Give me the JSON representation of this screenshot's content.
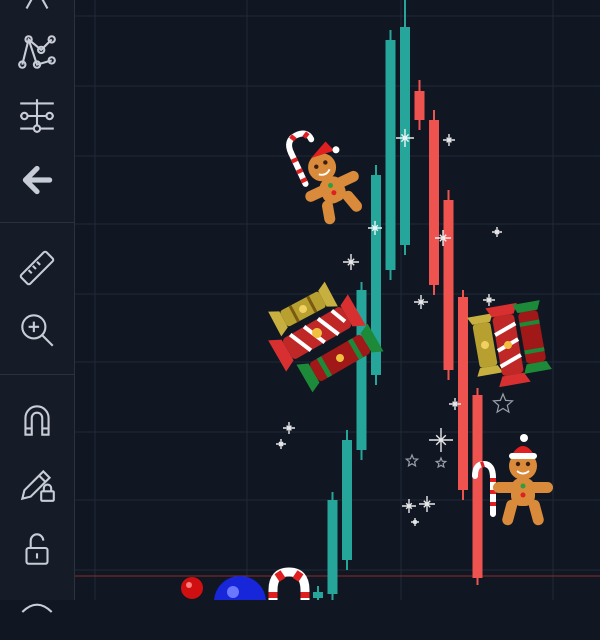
{
  "toolbar": {
    "tools": [
      {
        "name": "draw-tool-icon",
        "label": ""
      },
      {
        "name": "pattern-tool-icon",
        "label": ""
      },
      {
        "name": "measure-range-icon",
        "label": ""
      },
      {
        "name": "back-arrow-icon",
        "label": ""
      },
      {
        "name": "ruler-icon",
        "label": ""
      },
      {
        "name": "zoom-in-icon",
        "label": ""
      },
      {
        "name": "magnet-icon",
        "label": ""
      },
      {
        "name": "lock-drawing-icon",
        "label": ""
      },
      {
        "name": "unlock-icon",
        "label": ""
      }
    ]
  },
  "colors": {
    "background": "#111722",
    "toolbar": "#151b27",
    "grid": "#1f2a3a",
    "bull": "#26a69a",
    "bear": "#ef5350",
    "icon": "#c7ccd6",
    "price_line": "#8a2b2b"
  },
  "chart_data": {
    "type": "candlestick",
    "candles": [
      {
        "dir": "up",
        "open": 2,
        "close": 8,
        "high": 14,
        "low": 0
      },
      {
        "dir": "up",
        "open": 6,
        "close": 100,
        "high": 108,
        "low": 0
      },
      {
        "dir": "up",
        "open": 40,
        "close": 160,
        "high": 170,
        "low": 30
      },
      {
        "dir": "up",
        "open": 150,
        "close": 310,
        "high": 318,
        "low": 140
      },
      {
        "dir": "up",
        "open": 225,
        "close": 425,
        "high": 435,
        "low": 215
      },
      {
        "dir": "up",
        "open": 330,
        "close": 560,
        "high": 570,
        "low": 320
      },
      {
        "dir": "up",
        "open": 355,
        "close": 573,
        "high": 600,
        "low": 345
      },
      {
        "dir": "down",
        "open": 509,
        "close": 480,
        "high": 520,
        "low": 470
      },
      {
        "dir": "down",
        "open": 480,
        "close": 315,
        "high": 490,
        "low": 305
      },
      {
        "dir": "down",
        "open": 400,
        "close": 230,
        "high": 410,
        "low": 220
      },
      {
        "dir": "down",
        "open": 303,
        "close": 110,
        "high": 310,
        "low": 100
      },
      {
        "dir": "down",
        "open": 205,
        "close": 22,
        "high": 212,
        "low": 15
      }
    ],
    "decorations": [
      "gingerbread-man-with-candy-cane",
      "christmas-crackers",
      "gingerbread-man-with-santa-hat",
      "candy-cane",
      "christmas-ornaments",
      "sparkles"
    ]
  }
}
